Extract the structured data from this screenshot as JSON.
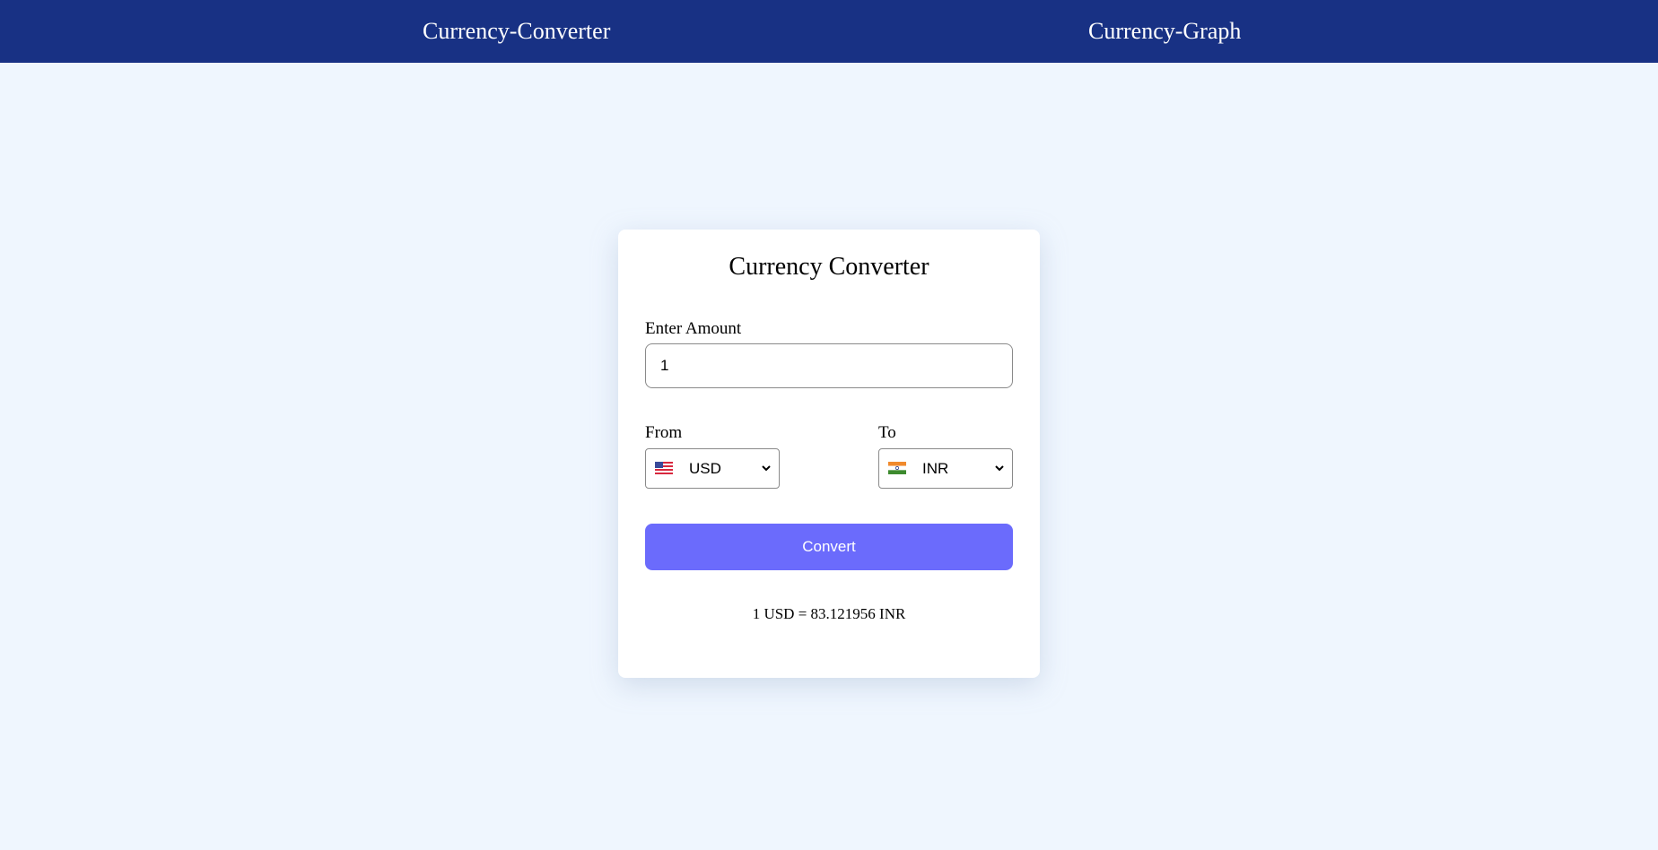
{
  "nav": {
    "converter_label": "Currency-Converter",
    "graph_label": "Currency-Graph"
  },
  "converter": {
    "title": "Currency Converter",
    "amount_label": "Enter Amount",
    "amount_value": "1",
    "from_label": "From",
    "to_label": "To",
    "from_currency": "USD",
    "from_flag": "us-flag-icon",
    "to_currency": "INR",
    "to_flag": "india-flag-icon",
    "convert_label": "Convert",
    "result_text": "1 USD = 83.121956 INR"
  },
  "colors": {
    "navbar": "#183184",
    "page_background": "#eff6fe",
    "button": "#6b6bfc"
  }
}
